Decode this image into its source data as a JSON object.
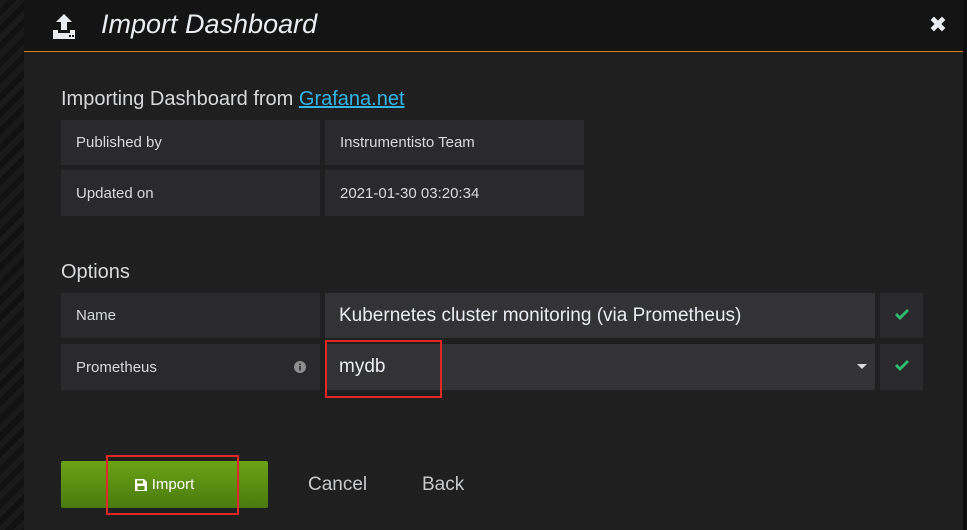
{
  "modal": {
    "title": "Import Dashboard",
    "close_label": "✖"
  },
  "source": {
    "heading_prefix": "Importing Dashboard from ",
    "link_text": "Grafana.net",
    "rows": [
      {
        "label": "Published by",
        "value": "Instrumentisto Team"
      },
      {
        "label": "Updated on",
        "value": "2021-01-30 03:20:34"
      }
    ]
  },
  "options": {
    "heading": "Options",
    "name": {
      "label": "Name",
      "value": "Kubernetes cluster monitoring (via Prometheus)"
    },
    "prometheus": {
      "label": "Prometheus",
      "selected": "mydb"
    }
  },
  "actions": {
    "import_label": "Import",
    "cancel_label": "Cancel",
    "back_label": "Back"
  },
  "colors": {
    "accent": "#d08519",
    "link": "#33b5e5",
    "success": "#2fbf71",
    "primary_button": "#5a8f12",
    "highlight": "#e02828"
  },
  "icons": {
    "header": "upload-icon",
    "close": "close-icon",
    "info": "info-icon",
    "check": "check-icon",
    "dropdown": "caret-down-icon",
    "save": "floppy-disk-icon"
  }
}
